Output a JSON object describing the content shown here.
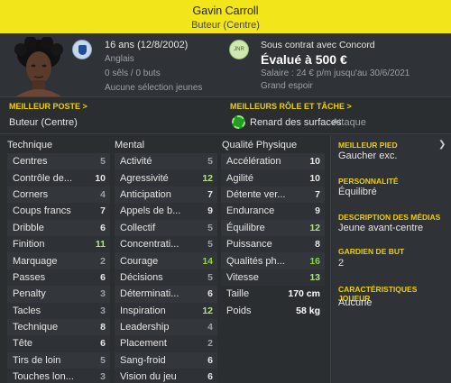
{
  "header": {
    "name": "Gavin Carroll",
    "position": "Buteur (Centre)"
  },
  "profile": {
    "age": "16 ans (12/8/2002)",
    "nationality": "Anglais",
    "caps": "0 sêls / 0 buts",
    "youth": "Aucune sélection jeunes",
    "club_badge_text": "JNR",
    "contract": "Sous contrat avec Concord",
    "value": "Évalué à 500 €",
    "salary": "Salaire : 24 € p/m jusqu'au 30/6/2021",
    "prospect": "Grand espoir"
  },
  "best_position": {
    "label": "MEILLEUR POSTE >",
    "value": "Buteur (Centre)"
  },
  "best_role": {
    "label": "MEILLEURS RÔLE ET TÂCHE >",
    "role": "Renard des surfaces",
    "duty": "Attaque"
  },
  "technique": {
    "title": "Technique",
    "rows": [
      {
        "name": "Centres",
        "value": "5",
        "tone": "gr"
      },
      {
        "name": "Contrôle de...",
        "value": "10",
        "tone": "w"
      },
      {
        "name": "Corners",
        "value": "4",
        "tone": "gr"
      },
      {
        "name": "Coups francs",
        "value": "7",
        "tone": "w"
      },
      {
        "name": "Dribble",
        "value": "6",
        "tone": "w"
      },
      {
        "name": "Finition",
        "value": "11",
        "tone": "lg"
      },
      {
        "name": "Marquage",
        "value": "2",
        "tone": "gr"
      },
      {
        "name": "Passes",
        "value": "6",
        "tone": "w"
      },
      {
        "name": "Penalty",
        "value": "3",
        "tone": "gr"
      },
      {
        "name": "Tacles",
        "value": "3",
        "tone": "gr"
      },
      {
        "name": "Technique",
        "value": "8",
        "tone": "w"
      },
      {
        "name": "Tête",
        "value": "6",
        "tone": "w"
      },
      {
        "name": "Tirs de loin",
        "value": "5",
        "tone": "gr"
      },
      {
        "name": "Touches lon...",
        "value": "3",
        "tone": "gr"
      }
    ]
  },
  "mental": {
    "title": "Mental",
    "rows": [
      {
        "name": "Activité",
        "value": "5",
        "tone": "gr"
      },
      {
        "name": "Agressivité",
        "value": "12",
        "tone": "lg"
      },
      {
        "name": "Anticipation",
        "value": "7",
        "tone": "w"
      },
      {
        "name": "Appels de b...",
        "value": "9",
        "tone": "w"
      },
      {
        "name": "Collectif",
        "value": "5",
        "tone": "gr"
      },
      {
        "name": "Concentrati...",
        "value": "5",
        "tone": "gr"
      },
      {
        "name": "Courage",
        "value": "14",
        "tone": "g"
      },
      {
        "name": "Décisions",
        "value": "5",
        "tone": "gr"
      },
      {
        "name": "Déterminati...",
        "value": "6",
        "tone": "w"
      },
      {
        "name": "Inspiration",
        "value": "12",
        "tone": "lg"
      },
      {
        "name": "Leadership",
        "value": "4",
        "tone": "gr"
      },
      {
        "name": "Placement",
        "value": "2",
        "tone": "gr"
      },
      {
        "name": "Sang-froid",
        "value": "6",
        "tone": "w"
      },
      {
        "name": "Vision du jeu",
        "value": "6",
        "tone": "w"
      }
    ]
  },
  "physical": {
    "title": "Qualité Physique",
    "rows": [
      {
        "name": "Accélération",
        "value": "10",
        "tone": "w"
      },
      {
        "name": "Agilité",
        "value": "10",
        "tone": "w"
      },
      {
        "name": "Détente ver...",
        "value": "7",
        "tone": "w"
      },
      {
        "name": "Endurance",
        "value": "9",
        "tone": "w"
      },
      {
        "name": "Équilibre",
        "value": "12",
        "tone": "lg"
      },
      {
        "name": "Puissance",
        "value": "8",
        "tone": "w"
      },
      {
        "name": "Qualités ph...",
        "value": "16",
        "tone": "g"
      },
      {
        "name": "Vitesse",
        "value": "13",
        "tone": "lg"
      }
    ],
    "height_label": "Taille",
    "height": "170 cm",
    "weight_label": "Poids",
    "weight": "58 kg"
  },
  "details": {
    "foot_label": "MEILLEUR PIED",
    "foot": "Gaucher exc.",
    "personality_label": "PERSONNALITÉ",
    "personality": "Équilibré",
    "media_label": "DESCRIPTION DES MÉDIAS",
    "media": "Jeune avant-centre",
    "gk_label": "GARDIEN DE BUT",
    "gk": "2",
    "traits_label": "CARACTÉRISTIQUES JOUEUR",
    "traits": "Aucune"
  },
  "colors": {
    "header": "#f2e51a",
    "accent": "#f0d000",
    "good": "#8bd449"
  }
}
